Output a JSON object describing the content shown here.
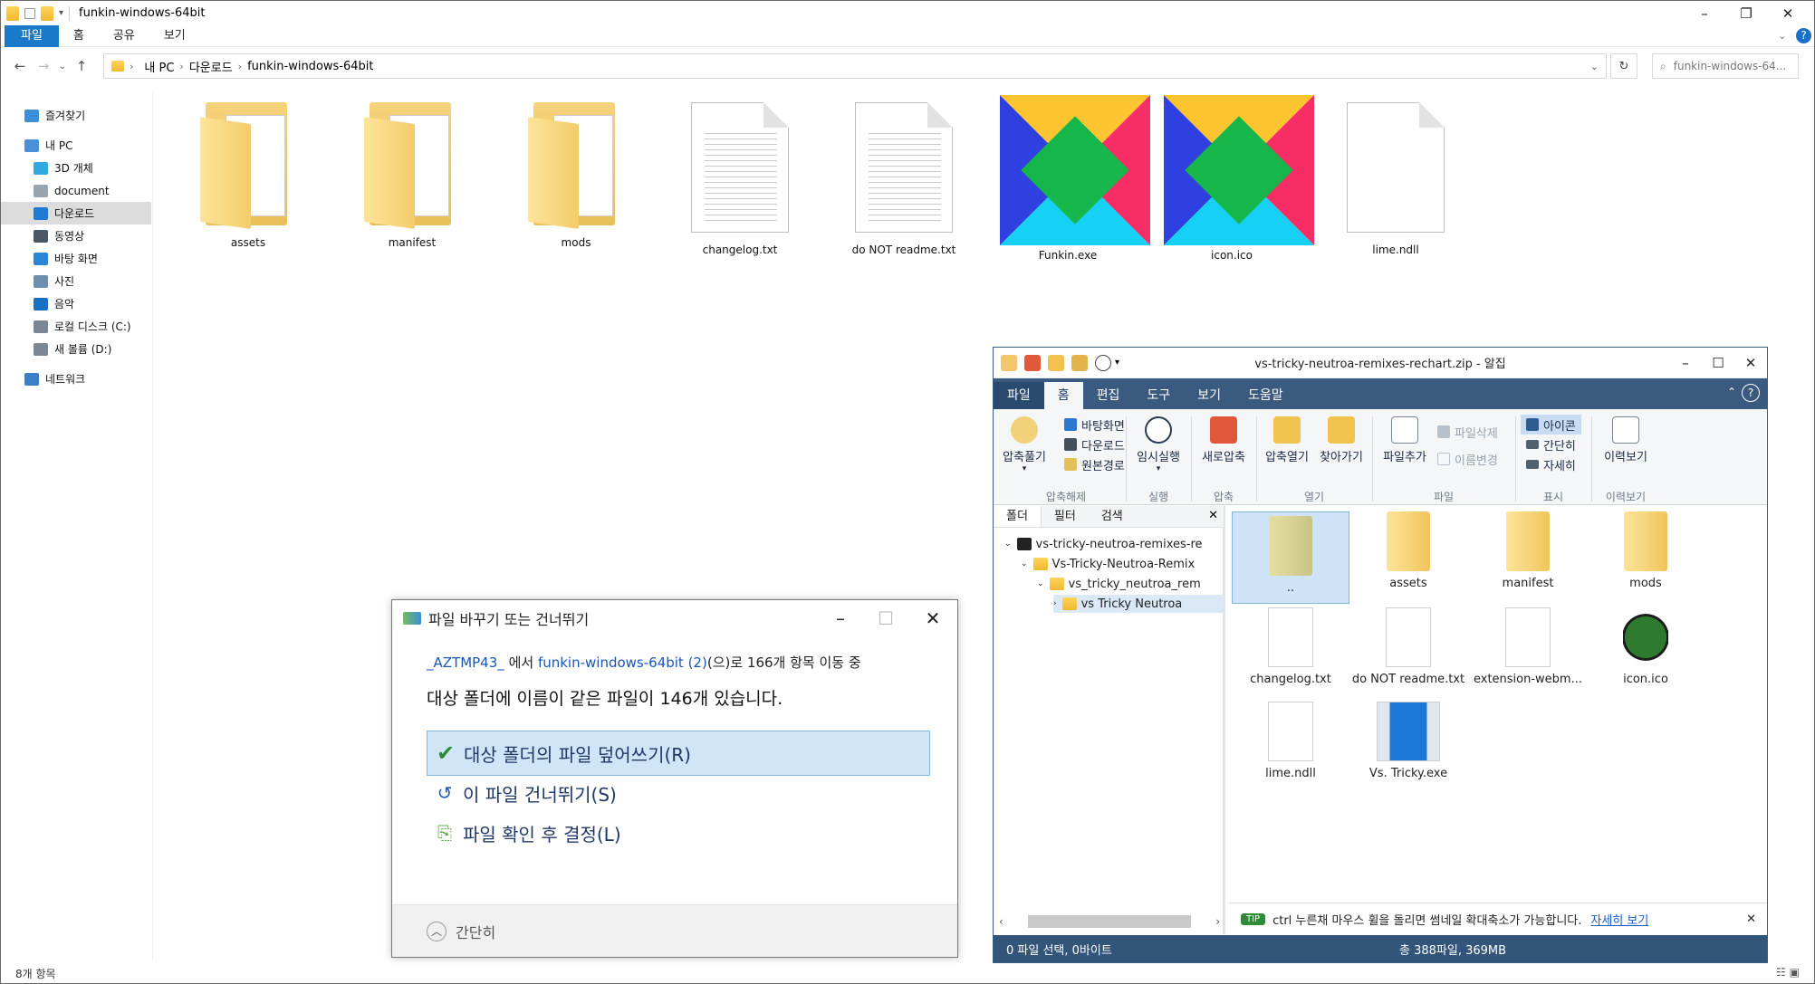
{
  "explorer": {
    "title": "funkin-windows-64bit",
    "tabs": [
      "파일",
      "홈",
      "공유",
      "보기"
    ],
    "breadcrumb": [
      "내 PC",
      "다운로드",
      "funkin-windows-64bit"
    ],
    "search_placeholder": "funkin-windows-64...",
    "nav": [
      {
        "label": "즐겨찾기",
        "icon": "star-icon",
        "color": "#3b8fd9",
        "indent": 0
      },
      {
        "label": "내 PC",
        "icon": "pc-icon",
        "color": "#4a90d8",
        "indent": 0
      },
      {
        "label": "3D 개체",
        "icon": "3d-objects-icon",
        "color": "#32a8e0",
        "indent": 1
      },
      {
        "label": "document",
        "icon": "documents-icon",
        "color": "#9aa4ad",
        "indent": 1
      },
      {
        "label": "다운로드",
        "icon": "download-icon",
        "color": "#1f7ad6",
        "indent": 1,
        "selected": true
      },
      {
        "label": "동영상",
        "icon": "video-icon",
        "color": "#4c5866",
        "indent": 1
      },
      {
        "label": "바탕 화면",
        "icon": "desktop-icon",
        "color": "#2c86d8",
        "indent": 1
      },
      {
        "label": "사진",
        "icon": "pictures-icon",
        "color": "#6f8fae",
        "indent": 1
      },
      {
        "label": "음악",
        "icon": "music-icon",
        "color": "#1a6fc2",
        "indent": 1
      },
      {
        "label": "로컬 디스크 (C:)",
        "icon": "disk-c-icon",
        "color": "#7c8794",
        "indent": 1
      },
      {
        "label": "새 볼륨 (D:)",
        "icon": "disk-d-icon",
        "color": "#7c8794",
        "indent": 1
      },
      {
        "label": "네트워크",
        "icon": "network-icon",
        "color": "#3a7fc7",
        "indent": 0
      }
    ],
    "items": [
      {
        "label": "assets",
        "kind": "folder"
      },
      {
        "label": "manifest",
        "kind": "folder"
      },
      {
        "label": "mods",
        "kind": "folder"
      },
      {
        "label": "changelog.txt",
        "kind": "text"
      },
      {
        "label": "do NOT readme.txt",
        "kind": "text"
      },
      {
        "label": "Funkin.exe",
        "kind": "funkin"
      },
      {
        "label": "icon.ico",
        "kind": "funkin"
      },
      {
        "label": "lime.ndll",
        "kind": "blank"
      }
    ],
    "status": "8개 항목"
  },
  "alzip": {
    "title": "vs-tricky-neutroa-remixes-rechart.zip - 알집",
    "tabs": [
      "파일",
      "홈",
      "편집",
      "도구",
      "보기",
      "도움말"
    ],
    "active_tab": "홈",
    "ribbon": {
      "extract": "압축풀기",
      "desktop": "바탕화면",
      "download": "다운로드",
      "original_path": "원본경로",
      "run_temp": "임시실행",
      "new_zip": "새로압축",
      "open_zip": "압축열기",
      "find": "찾아가기",
      "add_file": "파일추가",
      "delete_file": "파일삭제",
      "rename": "이름변경",
      "icon_view": "아이콘",
      "simple_view": "간단히",
      "detail_view": "자세히",
      "history": "이력보기",
      "groups": [
        "압축해제",
        "실행",
        "압축",
        "열기",
        "파일",
        "표시",
        "이력보기"
      ]
    },
    "left_tabs": [
      "폴더",
      "필터",
      "검색"
    ],
    "tree": [
      "vs-tricky-neutroa-remixes-re",
      "Vs-Tricky-Neutroa-Remix",
      "vs_tricky_neutroa_rem",
      "vs Tricky Neutroa"
    ],
    "files": [
      {
        "label": "..",
        "kind": "folder",
        "selected": true
      },
      {
        "label": "assets",
        "kind": "folder"
      },
      {
        "label": "manifest",
        "kind": "folder"
      },
      {
        "label": "mods",
        "kind": "folder"
      },
      {
        "label": "changelog.txt",
        "kind": "doc"
      },
      {
        "label": "do NOT readme.txt",
        "kind": "doc"
      },
      {
        "label": "extension-webm...",
        "kind": "doc"
      },
      {
        "label": "icon.ico",
        "kind": "tricky"
      },
      {
        "label": "lime.ndll",
        "kind": "doc"
      },
      {
        "label": "Vs. Tricky.exe",
        "kind": "exe"
      }
    ],
    "tip_badge": "TIP",
    "tip": "ctrl 누른채 마우스 휠을 돌리면 썸네일 확대축소가 가능합니다.",
    "tip_link": "자세히 보기",
    "status_left": "0 파일 선택, 0바이트",
    "status_right": "총 388파일, 369MB"
  },
  "dialog": {
    "title": "파일 바꾸기 또는 건너뛰기",
    "line1_src": "_AZTMP43_",
    "line1_mid": "에서",
    "line1_dst": "funkin-windows-64bit (2)",
    "line1_rest": "(으)로 166개 항목 이동 중",
    "line2": "대상 폴더에 이름이 같은 파일이 146개 있습니다.",
    "options": [
      "대상 폴더의 파일 덮어쓰기(R)",
      "이 파일 건너뛰기(S)",
      "파일 확인 후 결정(L)"
    ],
    "footer": "간단히"
  }
}
